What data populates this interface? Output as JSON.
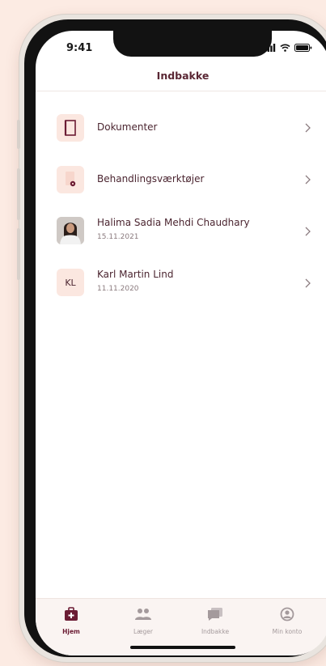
{
  "status_bar": {
    "time": "9:41"
  },
  "header": {
    "title": "Indbakke"
  },
  "inbox": {
    "items": [
      {
        "label": "Dokumenter",
        "icon": "document-icon"
      },
      {
        "label": "Behandlingsværktøjer",
        "icon": "treatment-tools-icon"
      },
      {
        "label": "Halima Sadia Mehdi Chaudhary",
        "date": "15.11.2021",
        "icon": "doctor-avatar"
      },
      {
        "label": "Karl Martin Lind",
        "date": "11.11.2020",
        "initials": "KL"
      }
    ]
  },
  "tabbar": {
    "tabs": [
      {
        "label": "Hjem",
        "icon": "home-medical-bag-icon",
        "active": true
      },
      {
        "label": "Læger",
        "icon": "doctors-people-icon",
        "active": false
      },
      {
        "label": "Indbakke",
        "icon": "inbox-chat-icon",
        "active": false
      },
      {
        "label": "Min konto",
        "icon": "account-icon",
        "active": false
      }
    ]
  },
  "colors": {
    "background": "#fcebe3",
    "accent": "#6b1c34",
    "text": "#4b2530",
    "thumb_bg": "#fbe7e0",
    "inactive": "#a49a9c"
  }
}
